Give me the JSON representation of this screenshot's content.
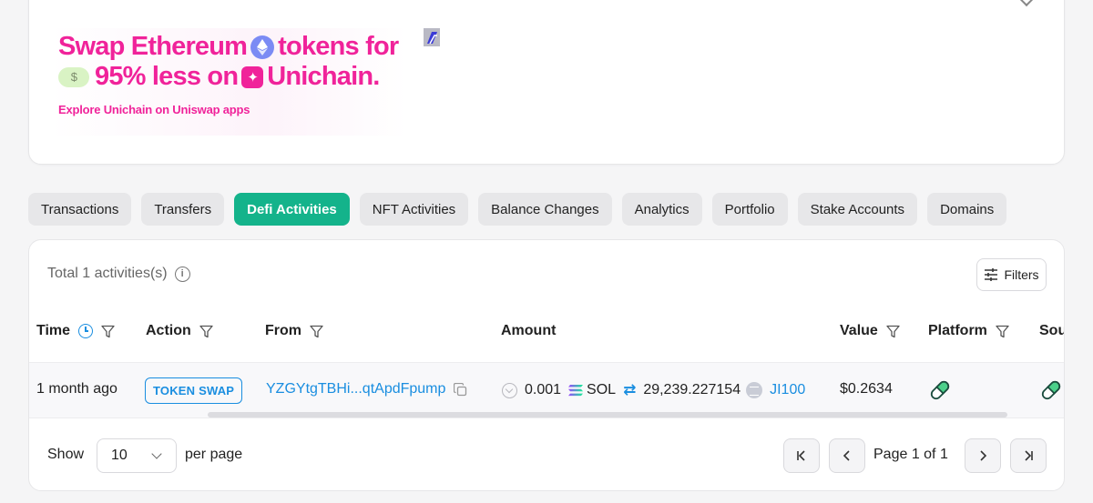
{
  "ad": {
    "line1_a": "Swap Ethereum",
    "line1_b": "tokens for",
    "dollar": "$",
    "line2_a": "95% less on",
    "line2_b": "Unichain.",
    "cta": "Explore Unichain on Uniswap apps",
    "brand_color": "#f0239a"
  },
  "tabs": [
    {
      "label": "Transactions"
    },
    {
      "label": "Transfers"
    },
    {
      "label": "Defi Activities",
      "active": true
    },
    {
      "label": "NFT Activities"
    },
    {
      "label": "Balance Changes"
    },
    {
      "label": "Analytics"
    },
    {
      "label": "Portfolio"
    },
    {
      "label": "Stake Accounts"
    },
    {
      "label": "Domains"
    }
  ],
  "activities": {
    "total_label": "Total 1 activities(s)",
    "filters_label": "Filters",
    "columns": {
      "time": "Time",
      "action": "Action",
      "from": "From",
      "amount": "Amount",
      "value": "Value",
      "platform": "Platform",
      "source": "Sou"
    },
    "rows": [
      {
        "time": "1 month ago",
        "action": "TOKEN SWAP",
        "from": "YZGYtgTBHi...qtApdFpump",
        "amount_in": "0.001",
        "token_in": "SOL",
        "amount_out": "29,239.227154",
        "token_out": "JI100",
        "value": "$0.2634"
      }
    ],
    "footer": {
      "show_label": "Show",
      "page_size": "10",
      "per_page_label": "per page",
      "page_info": "Page 1 of 1"
    }
  },
  "colors": {
    "accent": "#14b38b",
    "link": "#1a8ee0"
  }
}
